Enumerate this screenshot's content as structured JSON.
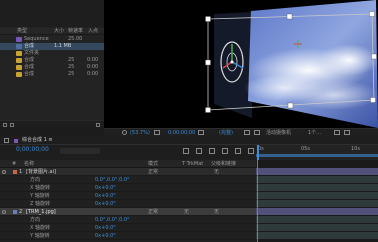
{
  "project": {
    "columns": {
      "name": "名称",
      "type": "类型",
      "size": "大小",
      "framerate": "帧速率",
      "in_point": "入点"
    },
    "items": [
      {
        "type": "Sequence",
        "size": "",
        "fps": "25.00",
        "color": "#7a57b8"
      },
      {
        "type": "合成",
        "size": "1.1 MB",
        "fps": "",
        "color": "#4f6fa3"
      },
      {
        "type": "文件夹",
        "size": "",
        "fps": "",
        "color": "#c9a233"
      },
      {
        "type": "合成",
        "size": "",
        "fps": "25",
        "in": "0:00",
        "color": "#c9a233"
      },
      {
        "type": "合成",
        "size": "",
        "fps": "25",
        "in": "0:00",
        "color": "#c9a233"
      },
      {
        "type": "合成",
        "size": "",
        "fps": "25",
        "in": "0:00",
        "color": "#c9a233"
      }
    ]
  },
  "viewer_toolbar": {
    "zoom": "(53.7%)",
    "timecode": "0;00;00;00",
    "quality": "(完整)",
    "camera": "活动摄像机",
    "views": "1个..."
  },
  "timeline": {
    "tab": "综合合成 1 ≡",
    "col_num": "#",
    "col_name": "名称",
    "col_mode": "模式",
    "col_trkmat": "T TrkMat",
    "col_parent": "父级和链接",
    "ruler_marks": [
      "0s",
      "05s",
      "10s"
    ],
    "layers": [
      {
        "num": "1",
        "name": "[背景图片.ai]",
        "mode": "正常",
        "parent": "无",
        "kind": "main",
        "color": "#c0694b"
      },
      {
        "num": "",
        "name": "方向",
        "value": "0.0°,0.0°,0.0°",
        "kind": "prop"
      },
      {
        "num": "",
        "name": "X 轴旋转",
        "value": "0x+0.0°",
        "kind": "prop"
      },
      {
        "num": "",
        "name": "Y 轴旋转",
        "value": "0x+0.0°",
        "kind": "prop"
      },
      {
        "num": "",
        "name": "Z 轴旋转",
        "value": "0x+0.0°",
        "kind": "prop"
      },
      {
        "num": "2",
        "name": "[TRM_1.jpg]",
        "mode": "正常",
        "trkmat": "无",
        "parent": "无",
        "kind": "main",
        "color": "#6b7fb5"
      },
      {
        "num": "",
        "name": "方向",
        "value": "0.0°,0.0°,0.0°",
        "kind": "prop"
      },
      {
        "num": "",
        "name": "X 轴旋转",
        "value": "0x+0.0°",
        "kind": "prop"
      },
      {
        "num": "",
        "name": "Y 轴旋转",
        "value": "0x+0.0°",
        "kind": "prop"
      },
      {
        "num": "",
        "name": "Z 轴旋转",
        "value": "0x+0.0°",
        "kind": "prop"
      }
    ]
  },
  "colors": {
    "accent_blue": "#3f8bd6",
    "keyframe_green": "#4caf50",
    "track_main": "#50507a",
    "track_prop": "#2f3a3a"
  }
}
